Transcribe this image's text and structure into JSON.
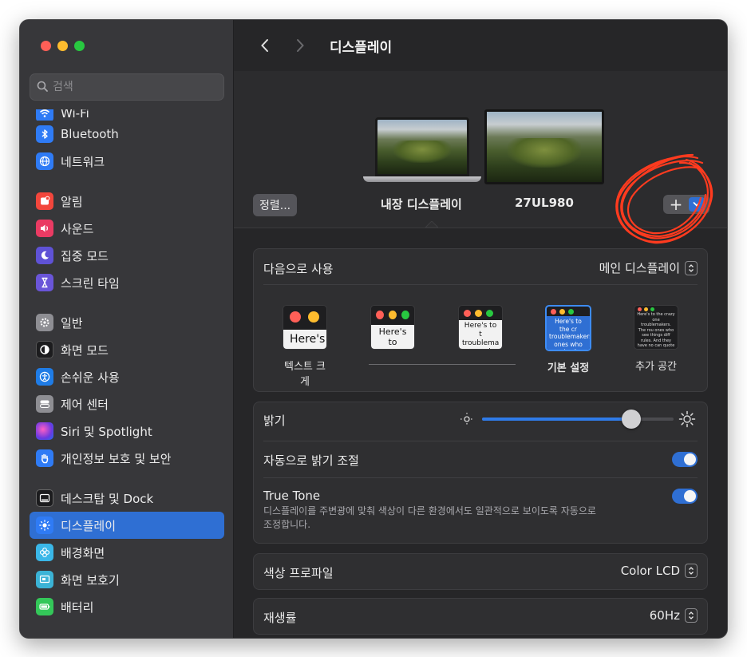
{
  "sidebar": {
    "search_placeholder": "검색",
    "partial_item": "Wi-Fi",
    "items": [
      {
        "label": "Bluetooth",
        "color": "#2f7bf5"
      },
      {
        "label": "네트워크",
        "color": "#2f7bf5"
      },
      {
        "label": "알림",
        "color": "#f2463c"
      },
      {
        "label": "사운드",
        "color": "#ea3b63"
      },
      {
        "label": "집중 모드",
        "color": "#5f52d6"
      },
      {
        "label": "스크린 타임",
        "color": "#6a55d8"
      },
      {
        "label": "일반",
        "color": "#8e8e93"
      },
      {
        "label": "화면 모드",
        "color": "#1c1c1e"
      },
      {
        "label": "손쉬운 사용",
        "color": "#1f7ce6"
      },
      {
        "label": "제어 센터",
        "color": "#8e8e93"
      },
      {
        "label": "Siri 및 Spotlight",
        "color": "#b14adf"
      },
      {
        "label": "개인정보 보호 및 보안",
        "color": "#2f7bf5"
      },
      {
        "label": "데스크탑 및 Dock",
        "color": "#1c1c1e"
      },
      {
        "label": "디스플레이",
        "color": "#2f7bf5"
      },
      {
        "label": "배경화면",
        "color": "#3ab7e8"
      },
      {
        "label": "화면 보호기",
        "color": "#3bb3d6"
      },
      {
        "label": "배터리",
        "color": "#34c759"
      }
    ]
  },
  "toolbar": {
    "title": "디스플레이"
  },
  "displays": {
    "arrange_label": "정렬...",
    "builtin_label": "내장 디스플레이",
    "external_label": "27UL980",
    "add_label": "+"
  },
  "use_as": {
    "label": "다음으로 사용",
    "value": "메인 디스플레이"
  },
  "resolution": {
    "options": [
      {
        "label": "텍스트 크게",
        "sample": "Here's"
      },
      {
        "label": "",
        "sample": "Here's to troublem"
      },
      {
        "label": "",
        "sample": "Here's to t troublema ones who"
      },
      {
        "label": "기본 설정",
        "sample": "Here's to the cr troublemakers. ones who see t rules. And they"
      },
      {
        "label": "추가 공간",
        "sample": "Here's to the crazy one troublemakers. The rou ones who see things diff rules. And they have no can quote them, disagre them. About the only th Because they change th"
      }
    ],
    "selected_index": 3
  },
  "brightness": {
    "label": "밝기",
    "level": 0.78
  },
  "auto_brightness": {
    "label": "자동으로 밝기 조절",
    "on": true
  },
  "true_tone": {
    "label": "True Tone",
    "desc_line1": "디스플레이를 주변광에 맞춰 색상이 다른 환경에서도 일관적으로 보이도록 자동으로",
    "desc_line2": "조정합니다.",
    "on": true
  },
  "color_profile": {
    "label": "색상 프로파일",
    "value": "Color LCD"
  },
  "refresh_rate": {
    "label": "재생률",
    "value": "60Hz"
  }
}
